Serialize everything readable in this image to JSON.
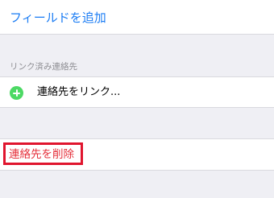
{
  "add_field": {
    "label": "フィールドを追加"
  },
  "linked_contacts": {
    "section_header": "リンク済み連絡先",
    "link_button_label": "連絡先をリンク...",
    "icon": "plus-circle-icon",
    "icon_color": "#4cd964"
  },
  "delete_contact": {
    "label": "連絡先を削除",
    "label_color": "#e5303b",
    "highlight_color": "#e0152e"
  },
  "colors": {
    "background": "#efeff4",
    "accent_blue": "#1a7cf4"
  }
}
